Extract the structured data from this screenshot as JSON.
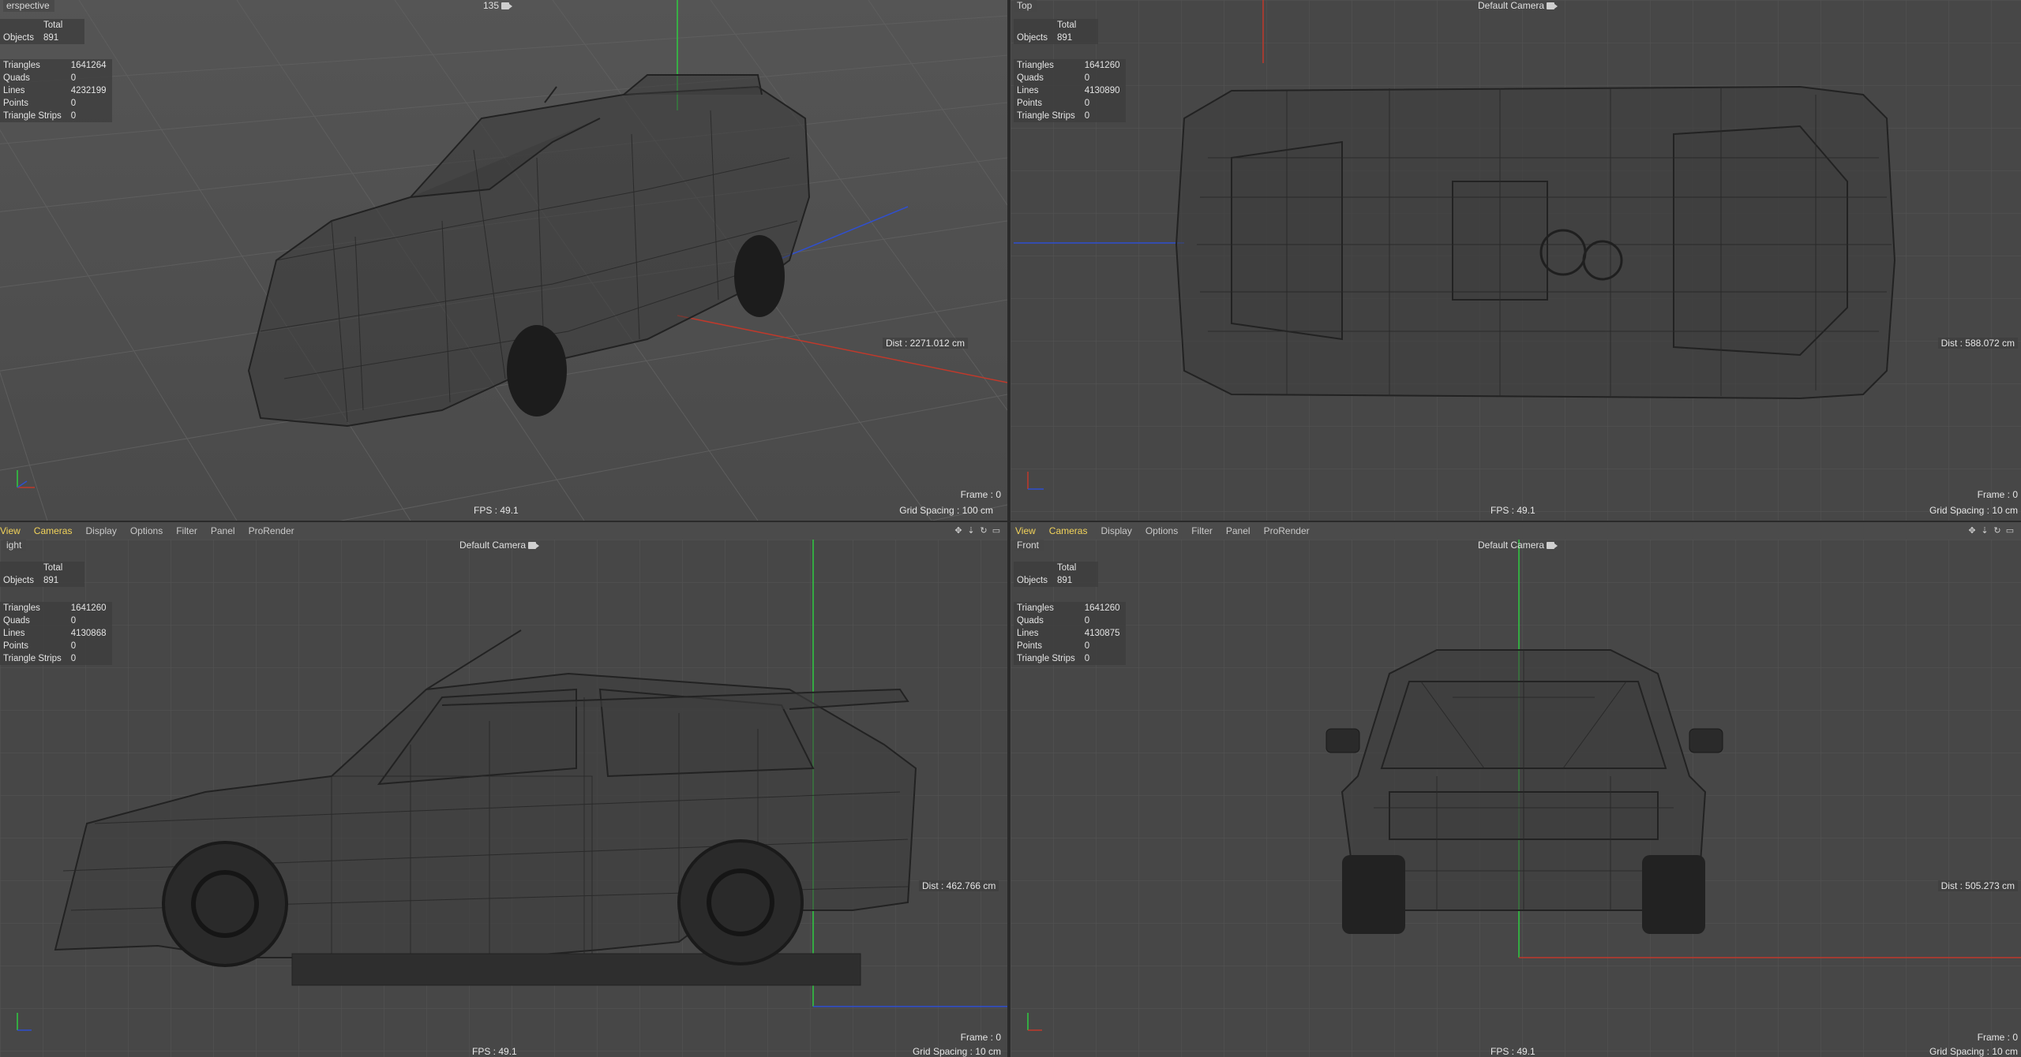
{
  "menubar": {
    "items": [
      "View",
      "Cameras",
      "Display",
      "Options",
      "Filter",
      "Panel",
      "ProRender"
    ],
    "active": [
      "View",
      "Cameras"
    ]
  },
  "viewports": {
    "perspective": {
      "name": "erspective",
      "camera": "135",
      "stats": {
        "header": "Total",
        "objects_label": "Objects",
        "objects": "891",
        "triangles_label": "Triangles",
        "triangles": "1641264",
        "quads_label": "Quads",
        "quads": "0",
        "lines_label": "Lines",
        "lines": "4232199",
        "points_label": "Points",
        "points": "0",
        "strips_label": "Triangle Strips",
        "strips": "0"
      },
      "dist": "Dist : 2271.012 cm",
      "frame": "Frame : 0",
      "fps": "FPS : 49.1",
      "grid": "Grid Spacing : 100 cm"
    },
    "top": {
      "name": "Top",
      "camera": "Default Camera",
      "stats": {
        "header": "Total",
        "objects_label": "Objects",
        "objects": "891",
        "triangles_label": "Triangles",
        "triangles": "1641260",
        "quads_label": "Quads",
        "quads": "0",
        "lines_label": "Lines",
        "lines": "4130890",
        "points_label": "Points",
        "points": "0",
        "strips_label": "Triangle Strips",
        "strips": "0"
      },
      "dist": "Dist : 588.072 cm",
      "frame": "Frame : 0",
      "fps": "FPS : 49.1",
      "grid": "Grid Spacing : 10 cm"
    },
    "right": {
      "name": "ight",
      "camera": "Default Camera",
      "stats": {
        "header": "Total",
        "objects_label": "Objects",
        "objects": "891",
        "triangles_label": "Triangles",
        "triangles": "1641260",
        "quads_label": "Quads",
        "quads": "0",
        "lines_label": "Lines",
        "lines": "4130868",
        "points_label": "Points",
        "points": "0",
        "strips_label": "Triangle Strips",
        "strips": "0"
      },
      "dist": "Dist : 462.766 cm",
      "frame": "Frame : 0",
      "fps": "FPS : 49.1",
      "grid": "Grid Spacing : 10 cm"
    },
    "front": {
      "name": "Front",
      "camera": "Default Camera",
      "stats": {
        "header": "Total",
        "objects_label": "Objects",
        "objects": "891",
        "triangles_label": "Triangles",
        "triangles": "1641260",
        "quads_label": "Quads",
        "quads": "0",
        "lines_label": "Lines",
        "lines": "4130875",
        "points_label": "Points",
        "points": "0",
        "strips_label": "Triangle Strips",
        "strips": "0"
      },
      "dist": "Dist : 505.273 cm",
      "frame": "Frame : 0",
      "fps": "FPS : 49.1",
      "grid": "Grid Spacing : 10 cm"
    }
  },
  "colors": {
    "axis_x": "#c0392b",
    "axis_y": "#2ecc40",
    "axis_z": "#2f4fd0",
    "active_menu": "#f2d35a",
    "viewport_bg": "#474747",
    "grid_line": "#555555",
    "wire": "#1e1e1e"
  }
}
